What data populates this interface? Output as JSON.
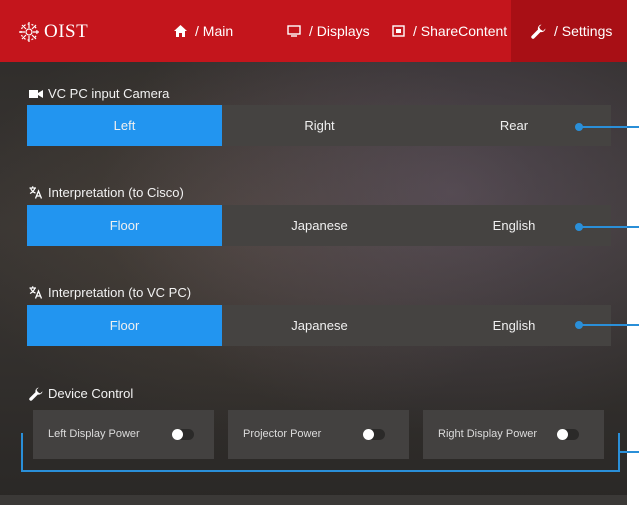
{
  "header": {
    "logo_text": "OIST",
    "tabs": [
      {
        "icon": "home-icon",
        "label": "/ Main"
      },
      {
        "icon": "display-icon",
        "label": "/ Displays"
      },
      {
        "icon": "share-icon",
        "label": "/ ShareContent"
      },
      {
        "icon": "wrench-icon",
        "label": "/ Settings",
        "active": true
      }
    ]
  },
  "sections": {
    "camera": {
      "label": "VC PC input Camera",
      "icon": "camera-icon",
      "options": [
        "Left",
        "Right",
        "Rear"
      ],
      "selected": "Left"
    },
    "interp_cisco": {
      "label": "Interpretation (to Cisco)",
      "icon": "translate-icon",
      "options": [
        "Floor",
        "Japanese",
        "English"
      ],
      "selected": "Floor"
    },
    "interp_vcpc": {
      "label": "Interpretation (to VC PC)",
      "icon": "translate-icon",
      "options": [
        "Floor",
        "Japanese",
        "English"
      ],
      "selected": "Floor"
    },
    "device_control": {
      "label": "Device Control",
      "icon": "wrench-icon",
      "items": [
        {
          "label": "Left Display Power",
          "on": false
        },
        {
          "label": "Projector Power",
          "on": false
        },
        {
          "label": "Right Display Power",
          "on": false
        }
      ]
    }
  },
  "colors": {
    "header_red": "#c4151c",
    "active_tab": "#a80f15",
    "selected_blue": "#2295f0",
    "annotation_blue": "#2a8fd8"
  }
}
